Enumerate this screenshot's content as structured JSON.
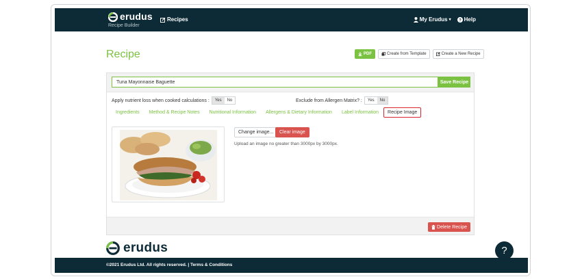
{
  "navbar": {
    "brand": "erudus",
    "brand_sub": "Recipe Builder",
    "recipes_link": "Recipes",
    "my_erudus": "My Erudus",
    "help": "Help"
  },
  "page": {
    "title": "Recipe",
    "pdf_label": "PDF",
    "create_template_label": "Create from Template",
    "create_new_label": "Create a New Recipe"
  },
  "recipe": {
    "name_value": "Tuna Mayonnaise Baguette",
    "save_label": "Save Recipe",
    "nutrient_loss_label": "Apply nutrient loss when cooked calculations :",
    "nutrient_loss_selected": "No",
    "allergen_label": "Exclude from Allergen Matrix? :",
    "allergen_selected": "No",
    "yes": "Yes",
    "no": "No"
  },
  "tabs": [
    {
      "label": "Ingredients",
      "active": false
    },
    {
      "label": "Method & Recipe Notes",
      "active": false
    },
    {
      "label": "Nutritional Information",
      "active": false
    },
    {
      "label": "Allergens & Dietary Information",
      "active": false
    },
    {
      "label": "Label Information",
      "active": false
    },
    {
      "label": "Recipe Image",
      "active": true
    }
  ],
  "image_section": {
    "change_label": "Change image...",
    "clear_label": "Clear image",
    "hint": "Upload an image no greater than 3000px by 3000px."
  },
  "delete_label": "Delete Recipe",
  "footer": {
    "brand": "erudus",
    "text": "©2021 Erudus Ltd. All rights reserved. | Terms & Conditions"
  },
  "help_fab": "?",
  "colors": {
    "navy": "#0d2b36",
    "green": "#7cc242",
    "red": "#d9534f",
    "active_tab_border": "#d9262c"
  }
}
